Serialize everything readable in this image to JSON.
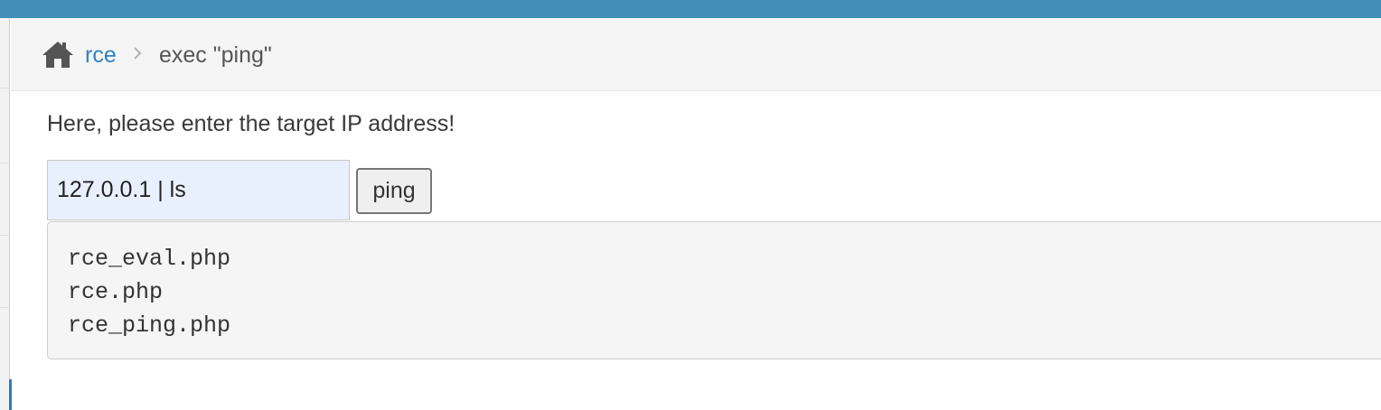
{
  "breadcrumb": {
    "home_icon": "home-icon",
    "link_label": "rce",
    "separator_icon": "chevron-right-icon",
    "current_label": "exec \"ping\""
  },
  "form": {
    "prompt": "Here, please enter the target IP address!",
    "ip_value": "127.0.0.1 | ls",
    "submit_label": "ping"
  },
  "output": {
    "lines": [
      "rce_eval.php",
      "rce.php",
      "rce_ping.php"
    ]
  },
  "colors": {
    "top_bar": "#438eb9",
    "link": "#2c83c3",
    "input_background": "#e8f0fe",
    "output_background": "#f5f5f5"
  }
}
